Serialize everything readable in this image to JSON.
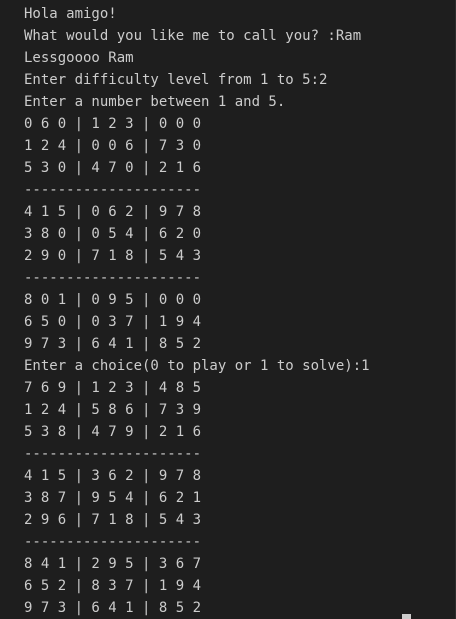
{
  "terminal": {
    "lines": [
      "Hola amigo!",
      "What would you like me to call you? :Ram",
      "Lessgoooo Ram",
      "Enter difficulty level from 1 to 5:2",
      "Enter a number between 1 and 5.",
      "0 6 0 | 1 2 3 | 0 0 0",
      "1 2 4 | 0 0 6 | 7 3 0",
      "5 3 0 | 4 7 0 | 2 1 6",
      "---------------------",
      "4 1 5 | 0 6 2 | 9 7 8",
      "3 8 0 | 0 5 4 | 6 2 0",
      "2 9 0 | 7 1 8 | 5 4 3",
      "---------------------",
      "8 0 1 | 0 9 5 | 0 0 0",
      "6 5 0 | 0 3 7 | 1 9 4",
      "9 7 3 | 6 4 1 | 8 5 2",
      "Enter a choice(0 to play or 1 to solve):1",
      "7 6 9 | 1 2 3 | 4 8 5",
      "1 2 4 | 5 8 6 | 7 3 9",
      "5 3 8 | 4 7 9 | 2 1 6",
      "---------------------",
      "4 1 5 | 3 6 2 | 9 7 8",
      "3 8 7 | 9 5 4 | 6 2 1",
      "2 9 6 | 7 1 8 | 5 4 3",
      "---------------------",
      "8 4 1 | 2 9 5 | 3 6 7",
      "6 5 2 | 8 3 7 | 1 9 4",
      "9 7 3 | 6 4 1 | 8 5 2"
    ]
  }
}
